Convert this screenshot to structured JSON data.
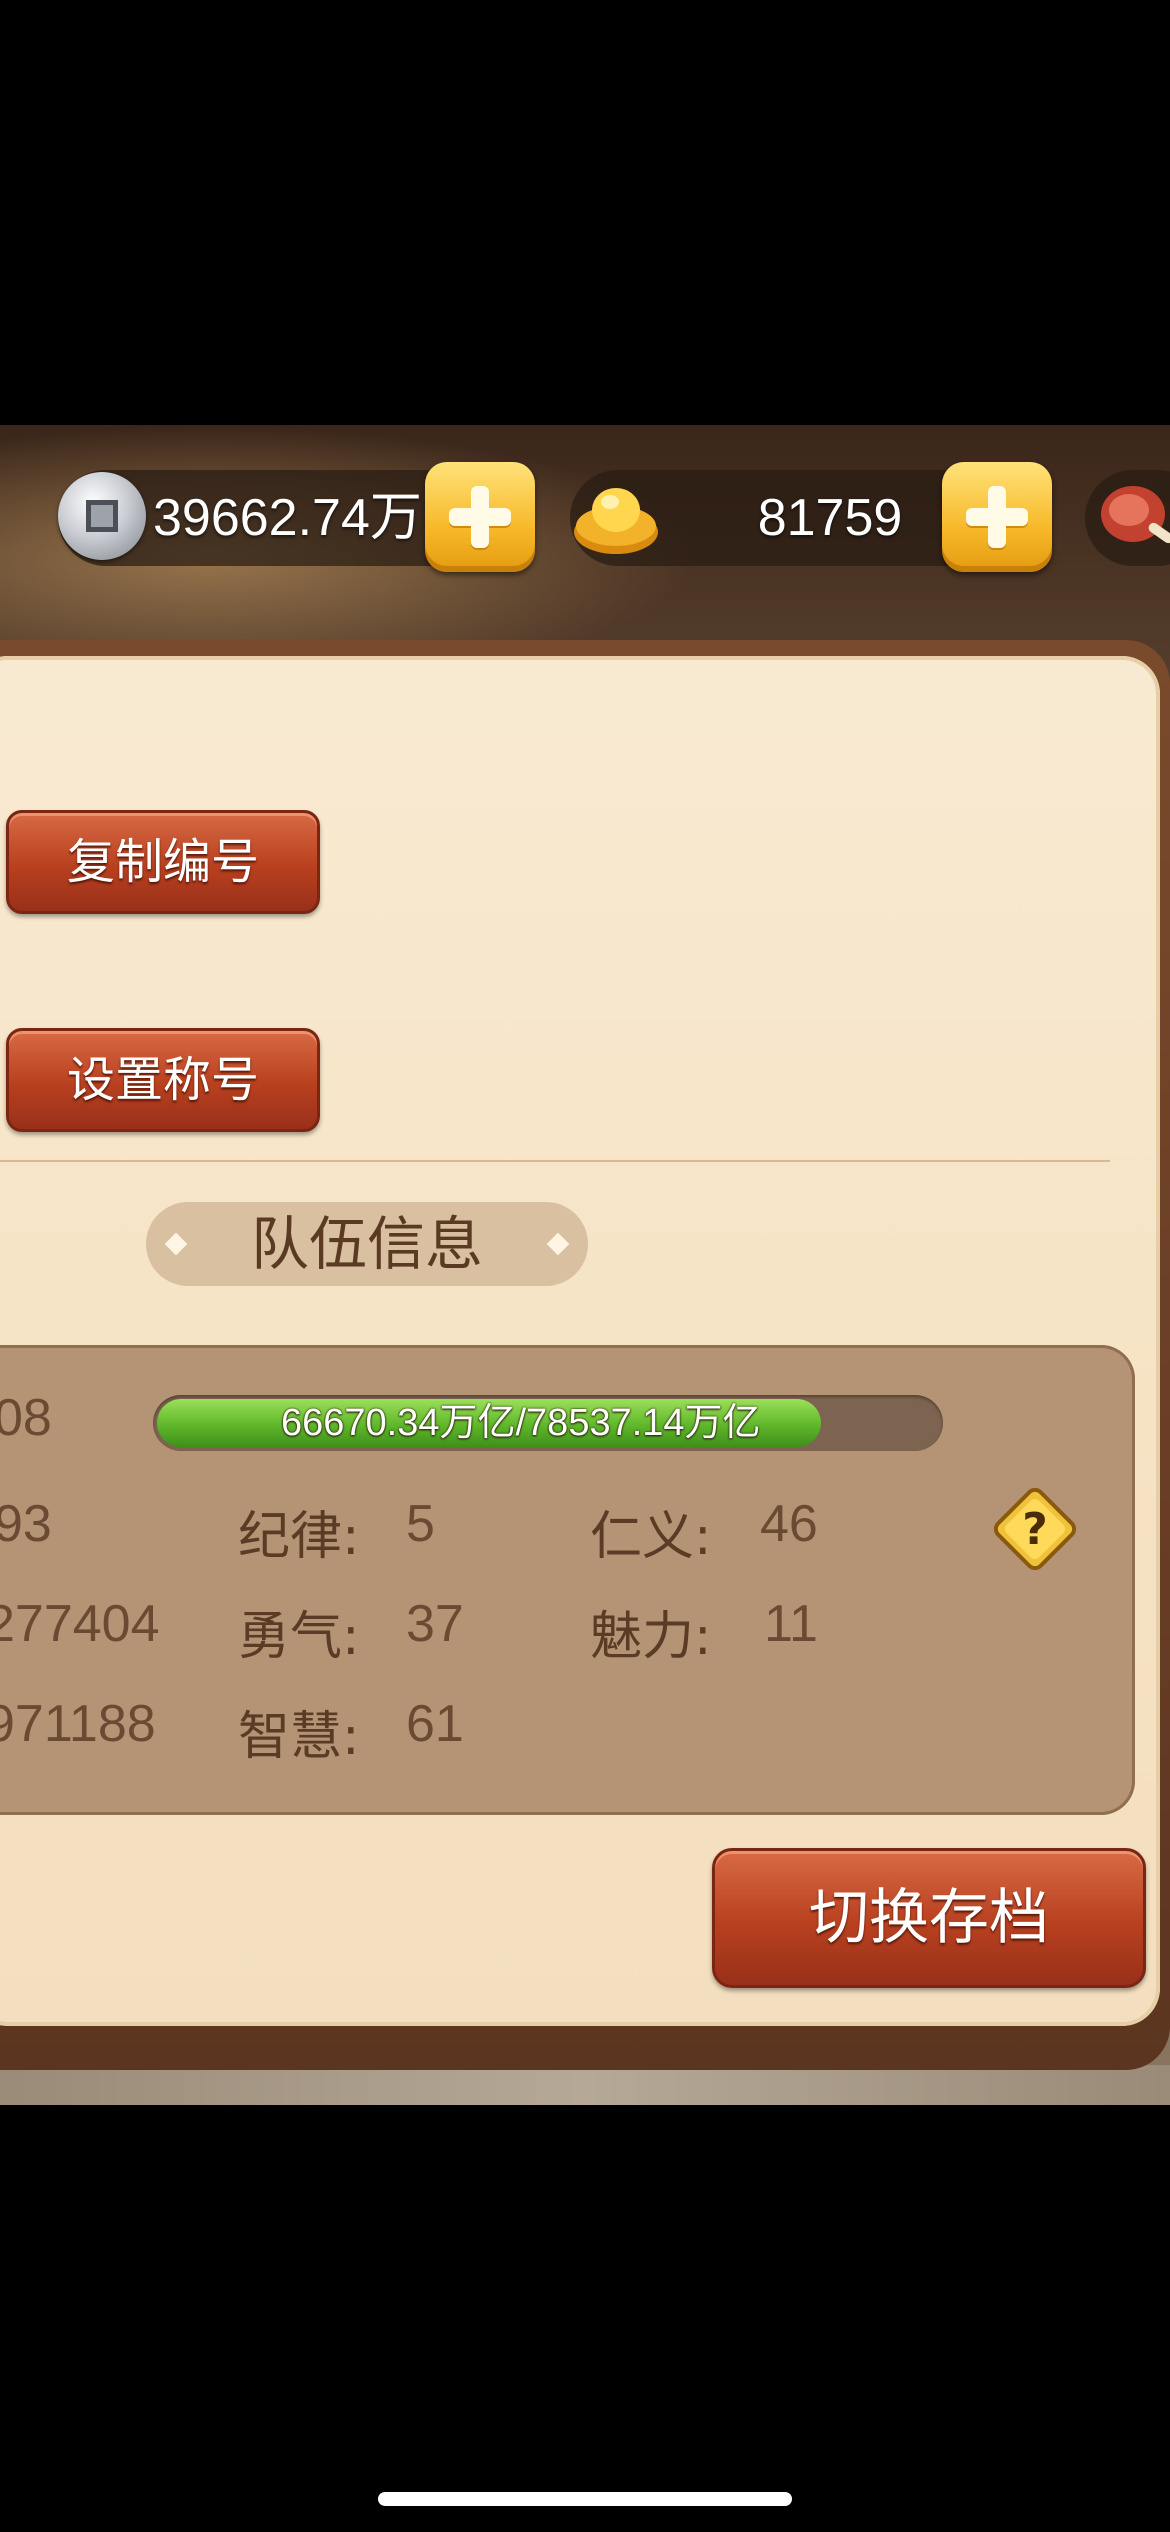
{
  "topbar": {
    "silver_value": "39662.74万",
    "gold_value": "81759"
  },
  "profile": {
    "copy_id_label": "复制编号",
    "set_title_label": "设置称号"
  },
  "team": {
    "section_title": "队伍信息",
    "hp_text": "66670.34万亿/78537.14万亿",
    "hp_fraction": 0.849,
    "left_values": [
      "08",
      "93",
      "277404",
      "971188"
    ],
    "attributes": [
      {
        "label": "纪律:",
        "value": "5"
      },
      {
        "label": "仁义:",
        "value": "46"
      },
      {
        "label": "勇气:",
        "value": "37"
      },
      {
        "label": "魅力:",
        "value": "11"
      },
      {
        "label": "智慧:",
        "value": "61"
      }
    ]
  },
  "actions": {
    "switch_save_label": "切换存档"
  },
  "colors": {
    "button_red": "#b8401f",
    "plus_yellow": "#f7b92a",
    "panel_cream": "#f6e3c4",
    "stats_bg": "#b49474",
    "hp_green": "#5fb72a"
  },
  "icons": [
    "silver-coin-icon",
    "gold-ingot-icon",
    "meat-icon",
    "plus-icon",
    "help-question-icon"
  ]
}
